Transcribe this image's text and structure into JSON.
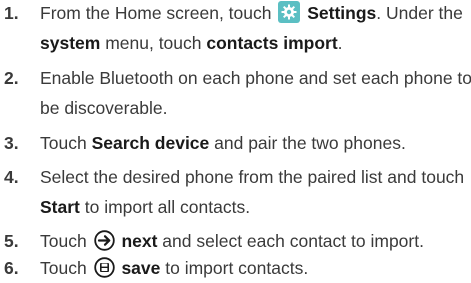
{
  "steps": [
    {
      "number": "1.",
      "line1_pre": "From the Home screen, touch ",
      "line1_bold": "Settings",
      "line1_post": ". Under the",
      "line2_bold1": "system",
      "line2_mid": " menu, touch ",
      "line2_bold2": "contacts import",
      "line2_post": ".",
      "icon": "settings-gear-icon"
    },
    {
      "number": "2.",
      "line1": "Enable Bluetooth on each phone and set each phone to",
      "line2": "be discoverable."
    },
    {
      "number": "3.",
      "line1_pre": "Touch ",
      "line1_bold": "Search device",
      "line1_post": " and pair the two phones."
    },
    {
      "number": "4.",
      "line1": "Select the desired phone from the paired list and touch",
      "line2_bold": "Start",
      "line2_post": " to import all contacts."
    },
    {
      "number": "5.",
      "line1_pre": "Touch ",
      "line1_bold": "next",
      "line1_post": " and select each contact to import.",
      "icon": "next-arrow-circle-icon"
    },
    {
      "number": "6.",
      "line1_pre": "Touch ",
      "line1_bold": "save",
      "line1_post": " to import contacts.",
      "icon": "save-circle-icon"
    }
  ],
  "colors": {
    "text": "#3a3a3a",
    "bold_text": "#1a1a1a",
    "settings_icon_bg": "#5bbfc3"
  }
}
